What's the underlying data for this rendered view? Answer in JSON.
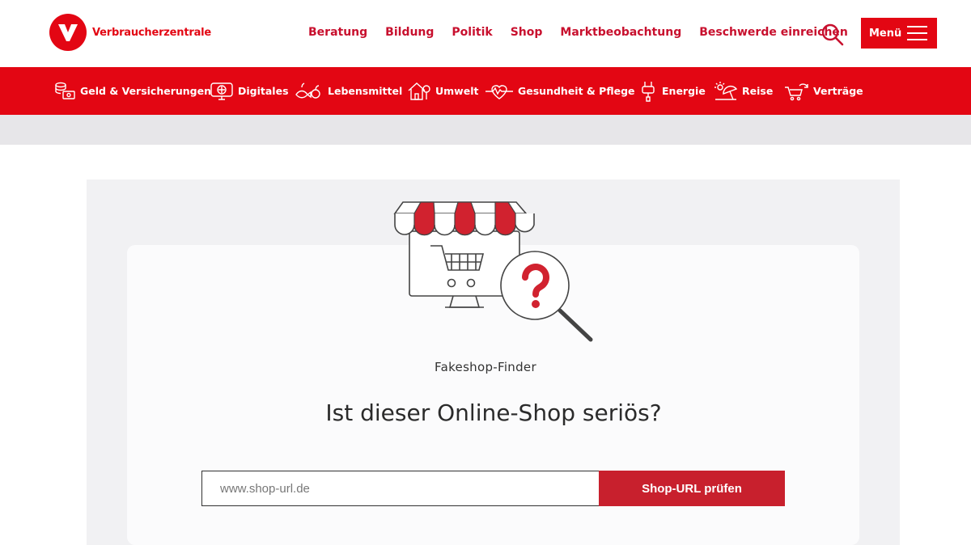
{
  "logo": {
    "text": "Verbraucherzentrale"
  },
  "topnav": [
    "Beratung",
    "Bildung",
    "Politik",
    "Shop",
    "Marktbeobachtung",
    "Beschwerde einreichen"
  ],
  "menu_button": "Menü",
  "categories": [
    {
      "label": "Geld & Versicherungen",
      "icon": "coins-icon"
    },
    {
      "label": "Digitales",
      "icon": "monitor-icon"
    },
    {
      "label": "Lebensmittel",
      "icon": "food-icon"
    },
    {
      "label": "Umwelt",
      "icon": "house-tree-icon"
    },
    {
      "label": "Gesundheit & Pflege",
      "icon": "heartbeat-icon"
    },
    {
      "label": "Energie",
      "icon": "plug-icon"
    },
    {
      "label": "Reise",
      "icon": "sun-umbrella-icon"
    },
    {
      "label": "Verträge",
      "icon": "cart-refresh-icon"
    }
  ],
  "finder": {
    "eyebrow": "Fakeshop-Finder",
    "headline": "Ist dieser Online-Shop seriös?",
    "input_placeholder": "www.shop-url.de",
    "button_label": "Shop-URL prüfen"
  },
  "colors": {
    "brand_red": "#e30613",
    "button_red": "#c8202d"
  }
}
